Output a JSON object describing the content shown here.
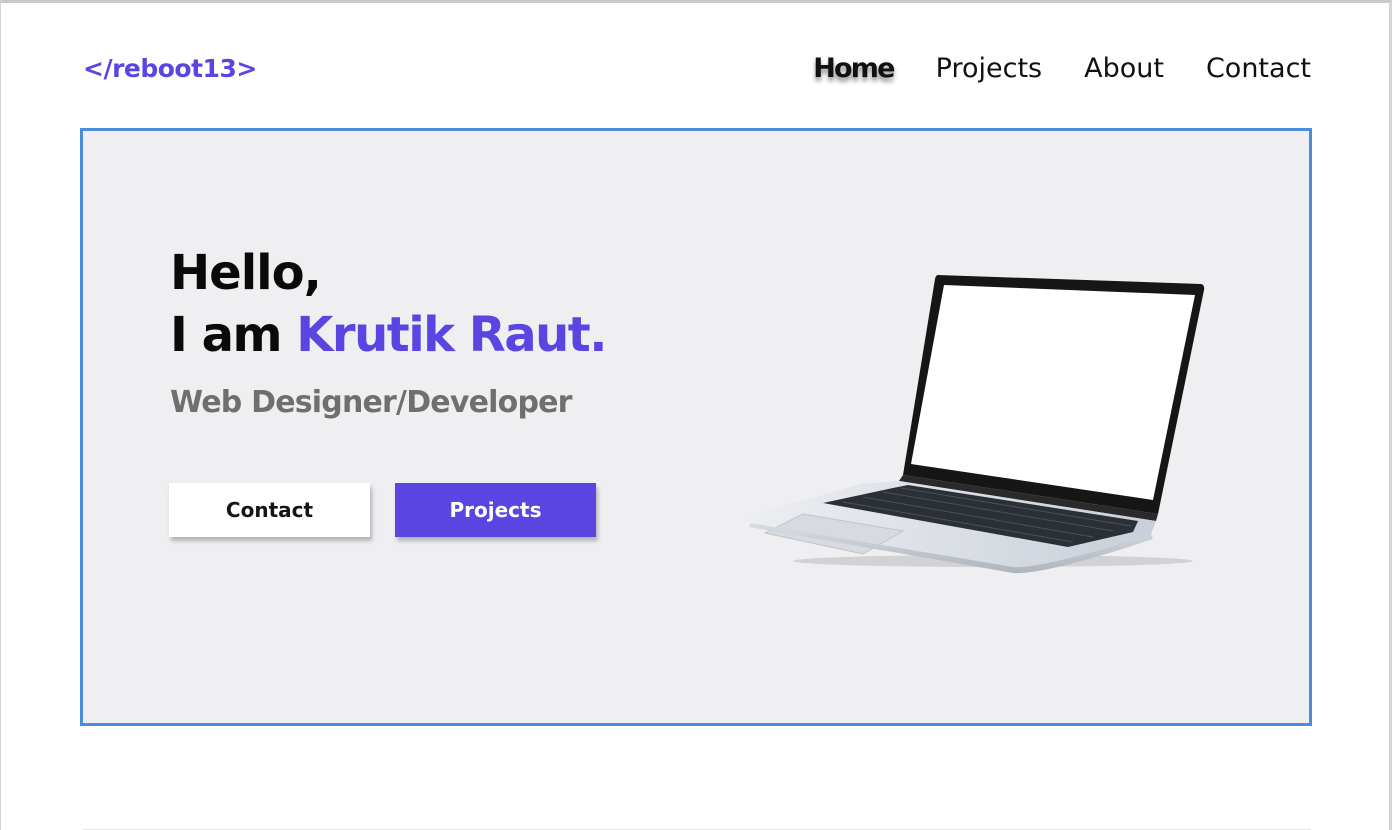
{
  "brand": {
    "logo": "</reboot13>"
  },
  "nav": {
    "items": [
      {
        "label": "Home",
        "active": true
      },
      {
        "label": "Projects",
        "active": false
      },
      {
        "label": "About",
        "active": false
      },
      {
        "label": "Contact",
        "active": false
      }
    ]
  },
  "hero": {
    "greeting": "Hello,",
    "intro_prefix": "I am",
    "name": "Krutik Raut.",
    "role": "Web Designer/Developer",
    "buttons": {
      "contact_label": "Contact",
      "projects_label": "Projects"
    },
    "image": "laptop-illustration"
  },
  "colors": {
    "accent": "#5a45e3",
    "hero_background": "#efeff2",
    "hero_border": "#4a8edb",
    "role_text": "#6f6f6f"
  }
}
